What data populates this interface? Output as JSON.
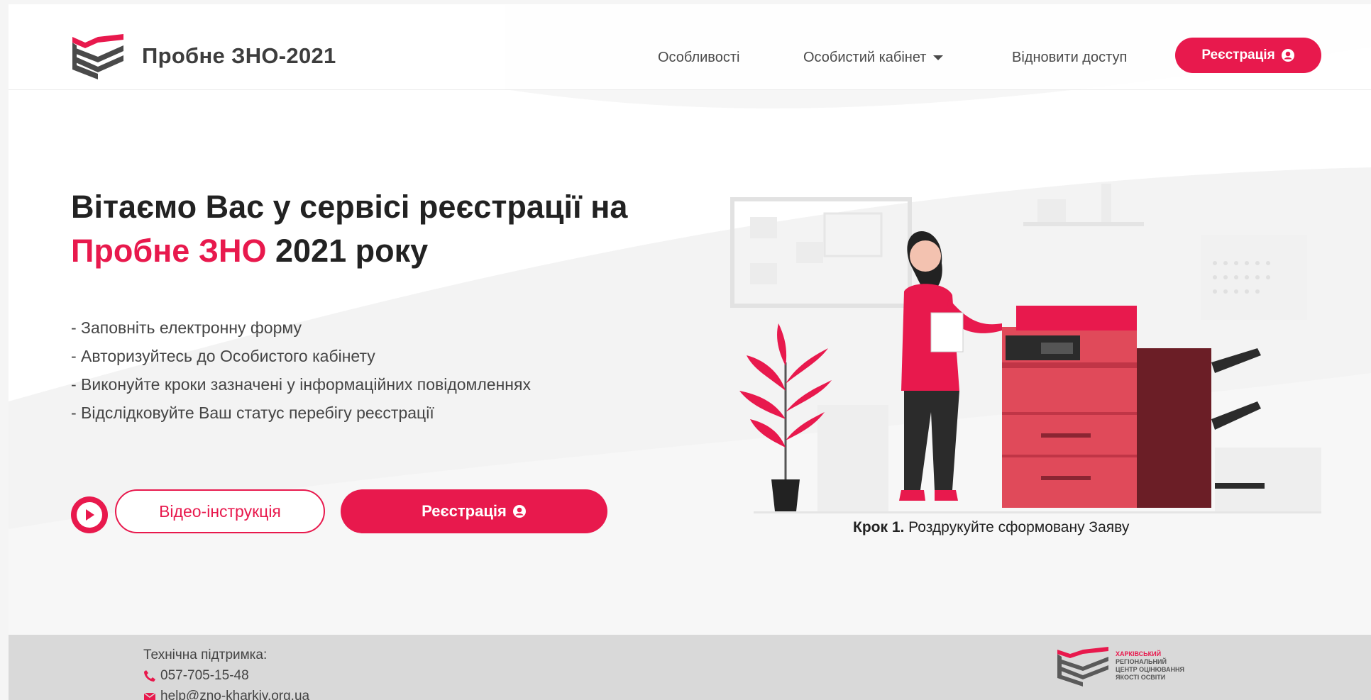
{
  "header": {
    "title": "Пробне ЗНО-2021",
    "nav": {
      "features": "Особливості",
      "cabinet": "Особистий кабінет",
      "restore": "Відновити доступ",
      "register": "Реєстрація"
    }
  },
  "hero": {
    "title_line1": "Вітаємо Вас у сервісі реєстрації на",
    "title_accent": "Пробне ЗНО",
    "title_rest": " 2021 року",
    "steps": [
      "- Заповніть електронну форму",
      "- Авторизуйтесь до Особистого кабінету",
      "- Виконуйте кроки зазначені у інформаційних повідомленнях",
      "- Відслідковуйте Ваш статус перебігу реєстрації"
    ],
    "video_button": "Відео-інструкція",
    "register_button": "Реєстрація"
  },
  "illustration": {
    "caption_bold": "Крок 1.",
    "caption_text": " Роздрукуйте сформовану Заяву"
  },
  "footer": {
    "support_label": "Технічна підтримка:",
    "phone": "057-705-15-48",
    "email": "help@zno-kharkiv.org.ua",
    "logo_lines": [
      "ХАРКІВСЬКИЙ",
      "РЕГІОНАЛЬНИЙ",
      "ЦЕНТР ОЦІНЮВАННЯ",
      "ЯКОСТІ ОСВІТИ"
    ]
  },
  "colors": {
    "accent": "#e8194d",
    "footer_bg": "#d9d9d9"
  }
}
